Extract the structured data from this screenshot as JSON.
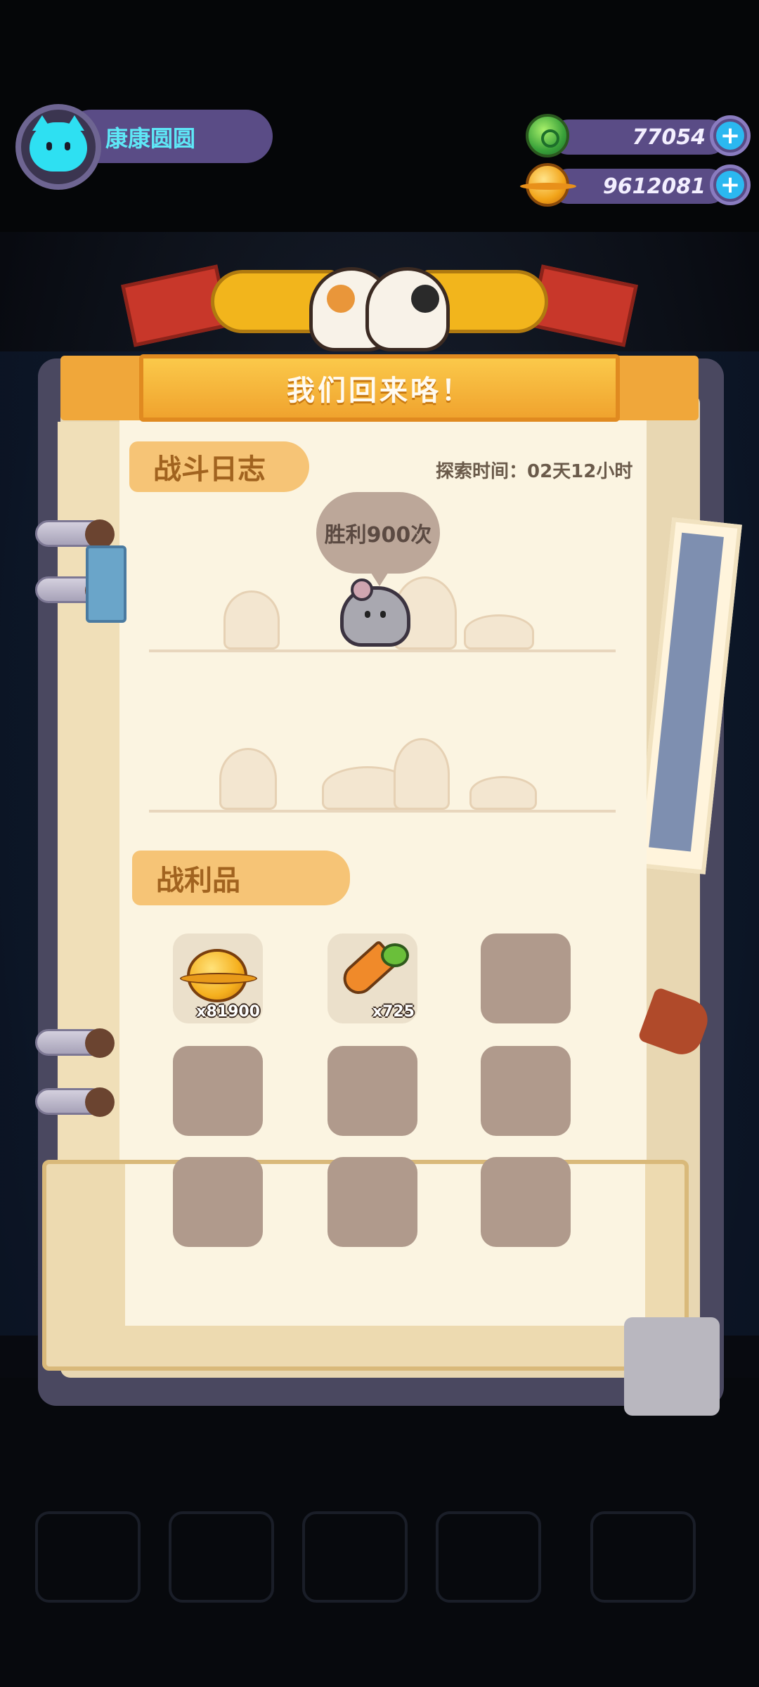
{
  "player": {
    "name": "康康圆圆"
  },
  "currencies": [
    {
      "name": "green-gem",
      "value": "77054"
    },
    {
      "name": "gold-coin",
      "value": "9612081"
    }
  ],
  "banner": {
    "title": "我们回来咯！"
  },
  "battle_log": {
    "label": "战斗日志",
    "explore_time": "探索时间：02天12小时",
    "bubble": "胜利900次"
  },
  "loot": {
    "label": "战利品",
    "items": [
      {
        "icon": "gold-coin-icon",
        "count": "x81900"
      },
      {
        "icon": "carrot-icon",
        "count": "x725"
      },
      {
        "icon": "",
        "count": ""
      },
      {
        "icon": "",
        "count": ""
      },
      {
        "icon": "",
        "count": ""
      },
      {
        "icon": "",
        "count": ""
      },
      {
        "icon": "",
        "count": ""
      },
      {
        "icon": "",
        "count": ""
      },
      {
        "icon": "",
        "count": ""
      }
    ]
  },
  "colors": {
    "accent_gold": "#f0a73a",
    "purple_bar": "#5a4c86",
    "page_bg": "#fbf4e1",
    "empty_slot": "#b09a8c",
    "label_brown": "#a1631f"
  }
}
